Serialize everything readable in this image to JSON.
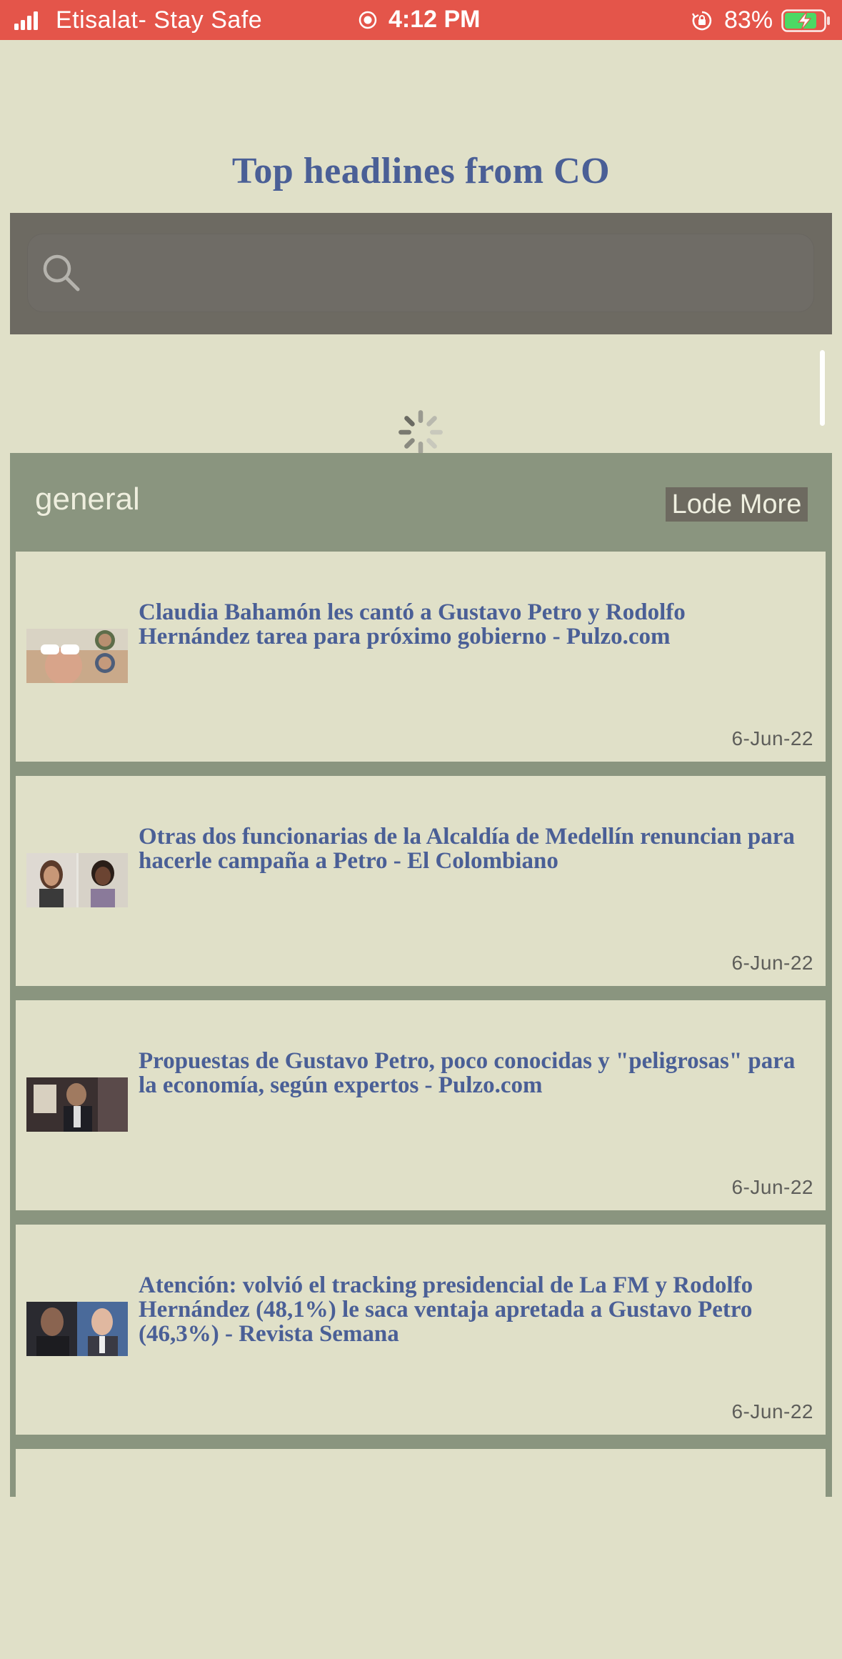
{
  "status_bar": {
    "carrier": "Etisalat- Stay Safe",
    "time": "4:12 PM",
    "battery_percent": "83%",
    "battery_level": 0.83,
    "status_bar_color": "#e4554a"
  },
  "page": {
    "title": "Top headlines from CO",
    "title_color": "#4a5f96"
  },
  "search": {
    "icon": "search-icon",
    "value": "",
    "placeholder": ""
  },
  "section": {
    "title": "general",
    "load_more_label": "Lode More"
  },
  "articles": [
    {
      "headline": "Claudia Bahamón les cantó a Gustavo Petro y Rodolfo Hernández tarea para próximo gobierno - Pulzo.com",
      "date": "6-Jun-22"
    },
    {
      "headline": "Otras dos funcionarias de la Alcaldía de Medellín renuncian para hacerle campaña a Petro - El Colombiano",
      "date": "6-Jun-22"
    },
    {
      "headline": "Propuestas de Gustavo Petro, poco conocidas y \"peligrosas\" para la economía, según expertos - Pulzo.com",
      "date": "6-Jun-22"
    },
    {
      "headline": "Atención: volvió el tracking presidencial de La FM y Rodolfo Hernández (48,1%) le saca ventaja apretada a Gustavo Petro (46,3%) - Revista Semana",
      "date": "6-Jun-22"
    }
  ]
}
